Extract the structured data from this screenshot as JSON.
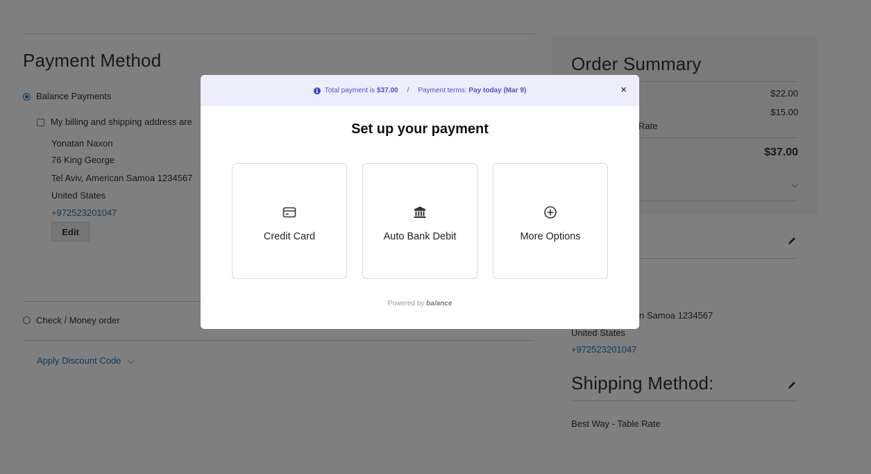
{
  "payment": {
    "title": "Payment Method",
    "balance_label": "Balance Payments",
    "same_address_label": "My billing and shipping address are",
    "address_lines": [
      "Yonatan Naxon",
      "76 King George",
      "Tel Aviv, American Samoa 1234567",
      "United States"
    ],
    "phone": "+972523201047",
    "edit_label": "Edit",
    "check_label": "Check / Money order",
    "discount_label": "Apply Discount Code"
  },
  "summary": {
    "title": "Order Summary",
    "amount_1": "$22.00",
    "amount_2": "$15.00",
    "rate_fragment": "Rate",
    "total": "$37.00"
  },
  "ship_to": {
    "address_fragment": "n Samoa 1234567",
    "country": "United States",
    "phone": "+972523201047"
  },
  "shipping_method": {
    "title": "Shipping Method:",
    "value": "Best Way - Table Rate"
  },
  "modal": {
    "info_prefix": "Total payment is",
    "total": "$37.00",
    "separator": "/",
    "terms_prefix": "Payment terms:",
    "terms_value": "Pay today (Mar 9)",
    "close_label": "×",
    "title": "Set up your payment",
    "options": [
      {
        "label": "Credit Card",
        "icon": "credit-card-icon"
      },
      {
        "label": "Auto Bank Debit",
        "icon": "bank-icon"
      },
      {
        "label": "More Options",
        "icon": "plus-circle-icon"
      }
    ],
    "powered_by": "Powered by",
    "brand": "ba/ance"
  }
}
